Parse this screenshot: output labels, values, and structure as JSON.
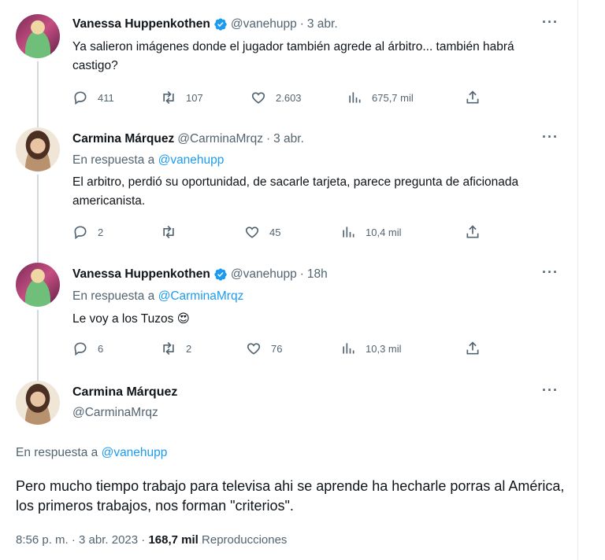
{
  "tweets": [
    {
      "name": "Vanessa Huppenkothen",
      "verified": true,
      "handle": "@vanehupp",
      "time": "3 abr.",
      "reply_prefix": "",
      "reply_handle": "",
      "text": "Ya salieron imágenes donde el jugador también agrede al árbitro... también habrá castigo?",
      "replies": "411",
      "retweets": "107",
      "likes": "2.603",
      "views": "675,7 mil"
    },
    {
      "name": "Carmina Márquez",
      "verified": false,
      "handle": "@CarminaMrqz",
      "time": "3 abr.",
      "reply_prefix": "En respuesta a",
      "reply_handle": "@vanehupp",
      "text": "El arbitro, perdió su oportunidad, de sacarle tarjeta, parece pregunta de aficionada americanista.",
      "replies": "2",
      "retweets": "",
      "likes": "45",
      "views": "10,4 mil"
    },
    {
      "name": "Vanessa Huppenkothen",
      "verified": true,
      "handle": "@vanehupp",
      "time": "18h",
      "reply_prefix": "En respuesta a",
      "reply_handle": "@CarminaMrqz",
      "text": "Le voy a los Tuzos 😍",
      "replies": "6",
      "retweets": "2",
      "likes": "76",
      "views": "10,3 mil"
    }
  ],
  "main_tweet": {
    "name": "Carmina Márquez",
    "handle": "@CarminaMrqz",
    "reply_prefix": "En respuesta a",
    "reply_handle": "@vanehupp",
    "text": "Pero mucho tiempo trabajo para televisa ahi se aprende ha hecharle porras al América, los primeros trabajos, nos forman \"criterios\".",
    "time": "8:56 p. m.",
    "date": "3 abr. 2023",
    "views_count": "168,7 mil",
    "views_label": "Reproducciones"
  },
  "separator_dot": "·",
  "more_label": "···",
  "colors": {
    "link": "#1d9bf0",
    "secondary": "#536471",
    "verified": "#1d9bf0"
  },
  "icons": [
    "reply-icon",
    "retweet-icon",
    "like-icon",
    "views-icon",
    "share-icon",
    "verified-icon",
    "more-icon"
  ]
}
